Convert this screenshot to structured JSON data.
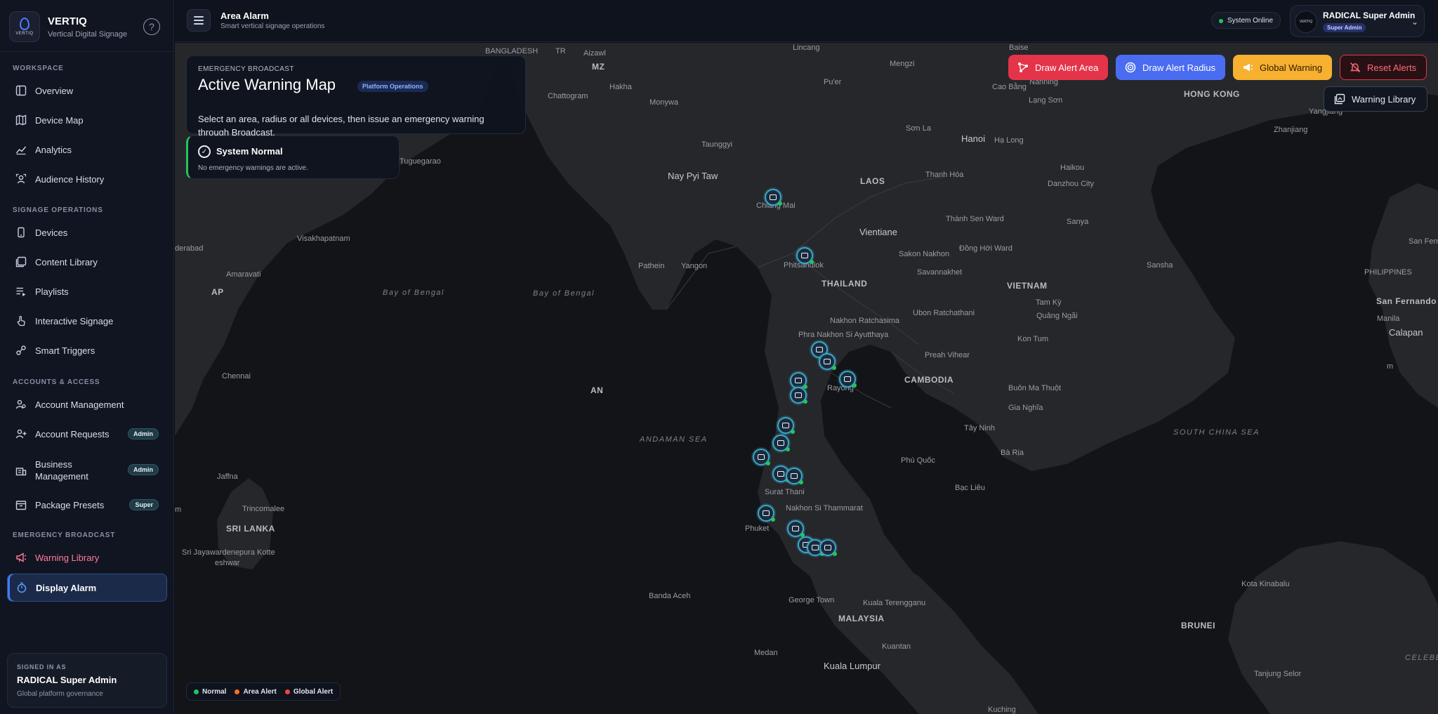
{
  "brand": {
    "name": "VERTIQ",
    "tagline": "Vertical Digital Signage",
    "logo_text": "VERTIQ"
  },
  "sidebar": {
    "sections": [
      {
        "label": "WORKSPACE"
      },
      {
        "label": "SIGNAGE OPERATIONS"
      },
      {
        "label": "ACCOUNTS & ACCESS"
      },
      {
        "label": "EMERGENCY BROADCAST"
      }
    ],
    "items": [
      {
        "label": "Overview",
        "icon": "overview-icon"
      },
      {
        "label": "Device Map",
        "icon": "map-icon"
      },
      {
        "label": "Analytics",
        "icon": "chart-icon"
      },
      {
        "label": "Audience History",
        "icon": "audience-icon"
      },
      {
        "label": "Devices",
        "icon": "device-icon"
      },
      {
        "label": "Content Library",
        "icon": "library-icon"
      },
      {
        "label": "Playlists",
        "icon": "playlist-icon"
      },
      {
        "label": "Interactive Signage",
        "icon": "touch-icon"
      },
      {
        "label": "Smart Triggers",
        "icon": "trigger-icon"
      },
      {
        "label": "Account Management",
        "icon": "users-icon"
      },
      {
        "label": "Account Requests",
        "icon": "user-add-icon",
        "badge": "Admin"
      },
      {
        "label": "Business Management",
        "label_line1": "Business",
        "label_line2": "Management",
        "icon": "business-icon",
        "badge": "Admin"
      },
      {
        "label": "Package Presets",
        "icon": "package-icon",
        "badge": "Super"
      },
      {
        "label": "Warning Library",
        "icon": "megaphone-icon"
      },
      {
        "label": "Display Alarm",
        "icon": "alarm-icon"
      }
    ],
    "signed_in": {
      "label": "SIGNED IN AS",
      "name": "RADICAL Super Admin",
      "role_desc": "Global platform governance"
    }
  },
  "topbar": {
    "title": "Area Alarm",
    "subtitle": "Smart vertical signage operations",
    "status": "System Online",
    "user": {
      "name": "RADICAL Super Admin",
      "role": "Super Admin",
      "avatar_text": "VERTIQ"
    }
  },
  "map": {
    "card": {
      "eyebrow": "EMERGENCY BROADCAST",
      "title": "Active Warning Map",
      "tag": "Platform Operations",
      "description": "Select an area, radius or all devices, then issue an emergency warning through Broadcast."
    },
    "status_card": {
      "title": "System Normal",
      "subtitle": "No emergency warnings are active."
    },
    "actions": {
      "draw_area": "Draw Alert Area",
      "draw_radius": "Draw Alert Radius",
      "global": "Global Warning",
      "reset": "Reset Alerts",
      "warning_library": "Warning Library"
    },
    "legend": [
      {
        "label": "Normal",
        "color": "#22c55e"
      },
      {
        "label": "Area Alert",
        "color": "#f97316"
      },
      {
        "label": "Global Alert",
        "color": "#ef4444"
      }
    ],
    "places": [
      "BANGLADESH",
      "TR",
      "Aizawl",
      "MZ",
      "Chattogram",
      "Hakha",
      "Monywa",
      "Lincang",
      "Mengzi",
      "Pu'er",
      "Baise",
      "Nanning",
      "Cao Bằng",
      "Lạng Sơn",
      "HONG KONG",
      "Yangjiang",
      "Zhanjiang",
      "Hanoi",
      "Hạ Long",
      "Sơn La",
      "Taunggyi",
      "Nay Pyi Taw",
      "LAOS",
      "Thanh Hóa",
      "Haikou",
      "Danzhou City",
      "Chiang Mai",
      "Thành Sen Ward",
      "Sanya",
      "Vientiane",
      "Đồng Hới Ward",
      "Sakon Nakhon",
      "Phitsanulok",
      "Savannakhet",
      "Sansha",
      "Pathein",
      "Yangon",
      "THAILAND",
      "VIETNAM",
      "Tam Kỳ",
      "Quảng Ngãi",
      "Ubon Ratchathani",
      "Nakhon Ratchasima",
      "Phra Nakhon Si Ayutthaya",
      "Kon Tum",
      "Preah Vihear",
      "CAMBODIA",
      "Buôn Ma Thuột",
      "Rayong",
      "Gia Nghĩa",
      "Tây Ninh",
      "Bà Rịa",
      "Phú Quốc",
      "Bạc Liêu",
      "Surat Thani",
      "Nakhon Si Thammarat",
      "Phuket",
      "Banda Aceh",
      "George Town",
      "Kuala Terengganu",
      "MALAYSIA",
      "Kuantan",
      "Kuala Lumpur",
      "Medan",
      "Kota Kinabalu",
      "BRUNEI",
      "Tanjung Selor",
      "Kuching",
      "Bay of Bengal",
      "Bay of Bengal",
      "ANDAMAN SEA",
      "SOUTH CHINA SEA",
      "CELEBES",
      "Visakhapatnam",
      "derabad",
      "Amaravati",
      "AP",
      "Chennai",
      "AN",
      "Jaffna",
      "Trincomalee",
      "SRI LANKA",
      "Sri Jayawardenepura Kotte",
      "eshwar",
      "Tuguegarao",
      "San Fernando",
      "PHILIPPINES",
      "San Fernando",
      "Manila",
      "Calapan",
      "m"
    ]
  },
  "colors": {
    "accent": "#3f7cff",
    "danger": "#e3344a",
    "warning": "#f7b02f",
    "radius": "#4a6cf0",
    "normal": "#22c55e"
  }
}
